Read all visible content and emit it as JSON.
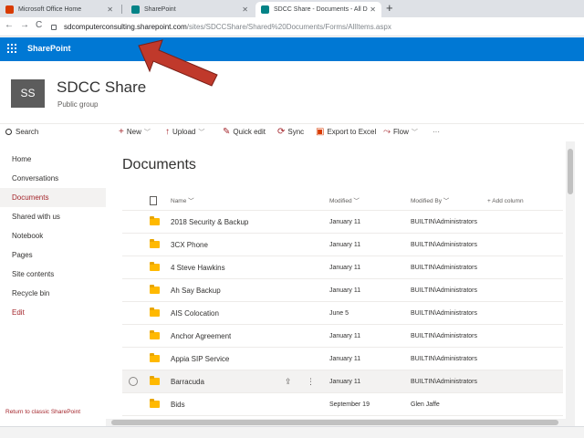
{
  "browser": {
    "tabs": [
      {
        "title": "Microsoft Office Home",
        "active": false
      },
      {
        "title": "SharePoint",
        "active": false
      },
      {
        "title": "SDCC Share - Documents - All D",
        "active": true
      }
    ],
    "url_host": "sdcomputerconsulting.sharepoint.com",
    "url_path": "/sites/SDCCShare/Shared%20Documents/Forms/AllItems.aspx"
  },
  "suite": {
    "app_name": "SharePoint"
  },
  "site": {
    "logo_initials": "SS",
    "title": "SDCC Share",
    "subtitle": "Public group"
  },
  "leftnav": {
    "search_label": "Search",
    "items": [
      "Home",
      "Conversations",
      "Documents",
      "Shared with us",
      "Notebook",
      "Pages",
      "Site contents",
      "Recycle bin",
      "Edit"
    ],
    "selected": "Documents",
    "return_link": "Return to classic SharePoint"
  },
  "commandbar": {
    "new": "New",
    "upload": "Upload",
    "quick_edit": "Quick edit",
    "sync": "Sync",
    "export": "Export to Excel",
    "flow": "Flow",
    "more": "···"
  },
  "library": {
    "title": "Documents",
    "columns": {
      "name": "Name",
      "modified": "Modified",
      "modified_by": "Modified By",
      "add_column": "+ Add column"
    },
    "rows": [
      {
        "name": "2018 Security & Backup",
        "modified": "January 11",
        "modified_by": "BUILTIN\\Administrators"
      },
      {
        "name": "3CX Phone",
        "modified": "January 11",
        "modified_by": "BUILTIN\\Administrators"
      },
      {
        "name": "4 Steve Hawkins",
        "modified": "January 11",
        "modified_by": "BUILTIN\\Administrators"
      },
      {
        "name": "Ah Say Backup",
        "modified": "January 11",
        "modified_by": "BUILTIN\\Administrators"
      },
      {
        "name": "AIS Colocation",
        "modified": "June 5",
        "modified_by": "BUILTIN\\Administrators"
      },
      {
        "name": "Anchor Agreement",
        "modified": "January 11",
        "modified_by": "BUILTIN\\Administrators"
      },
      {
        "name": "Appia SIP Service",
        "modified": "January 11",
        "modified_by": "BUILTIN\\Administrators"
      },
      {
        "name": "Barracuda",
        "modified": "January 11",
        "modified_by": "BUILTIN\\Administrators"
      },
      {
        "name": "Bids",
        "modified": "September 19",
        "modified_by": "Glen Jaffe"
      }
    ]
  },
  "colors": {
    "suite_bar": "#0078d4",
    "accent": "#a4262c",
    "folder": "#ffb900",
    "annotation_arrow": "#c0392b"
  }
}
